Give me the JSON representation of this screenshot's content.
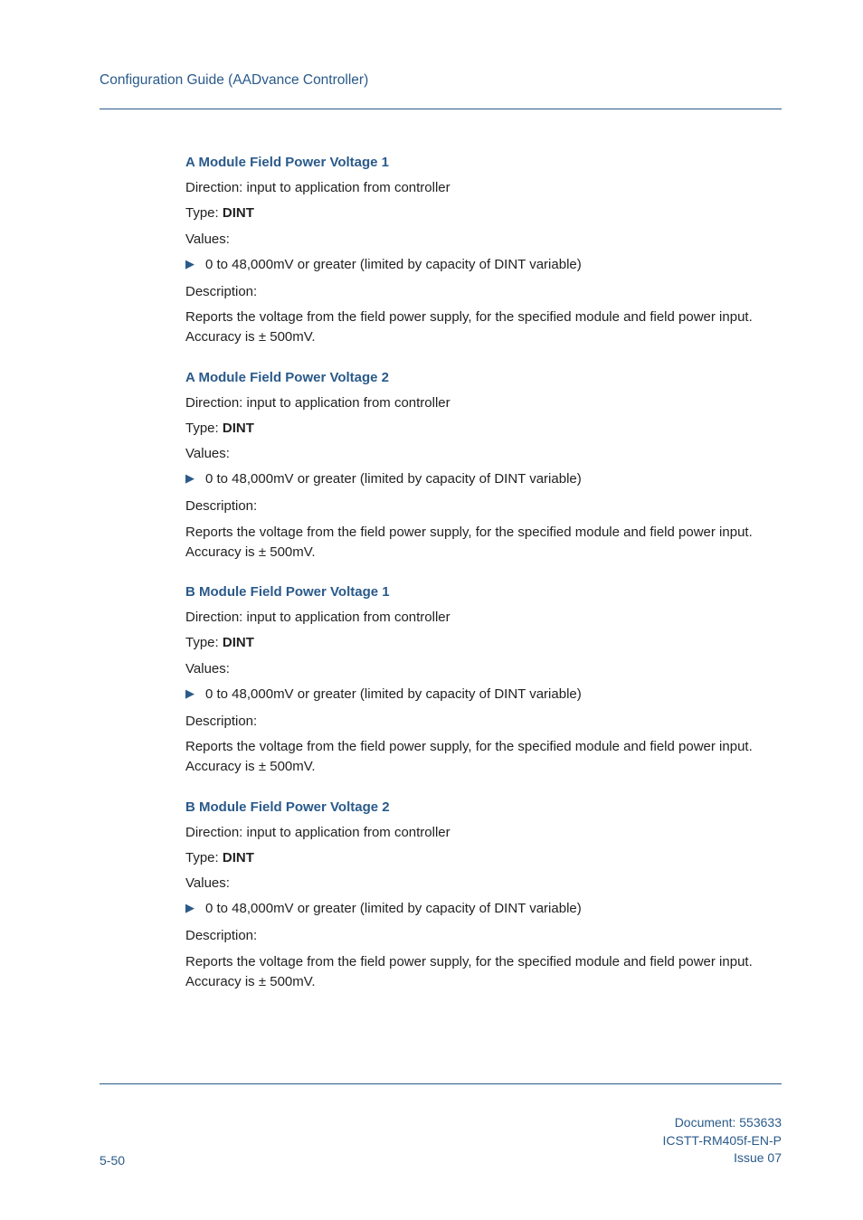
{
  "header": {
    "title": "Configuration Guide (AADvance Controller)"
  },
  "labels": {
    "direction": "Direction: input to application from controller",
    "type_prefix": "Type: ",
    "type_value": "DINT",
    "values_label": "Values:",
    "bullet_text": "0 to 48,000mV or greater (limited by capacity of DINT variable)",
    "description_label": "Description:",
    "description_body": "Reports the voltage from the field power supply, for the specified module and field power input. Accuracy is ± 500mV."
  },
  "sections": [
    {
      "title": "A Module Field Power Voltage 1"
    },
    {
      "title": "A Module Field Power Voltage 2"
    },
    {
      "title": "B Module Field Power Voltage 1"
    },
    {
      "title": "B Module Field Power Voltage 2"
    }
  ],
  "footer": {
    "page": "5-50",
    "doc": "Document: 553633",
    "pub": "ICSTT-RM405f-EN-P",
    "issue": "Issue 07"
  }
}
